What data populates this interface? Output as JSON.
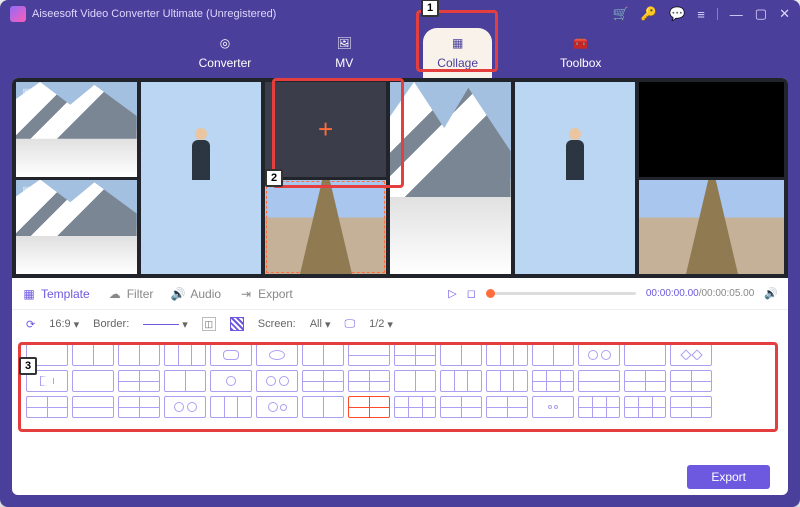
{
  "title": "Aiseesoft Video Converter Ultimate (Unregistered)",
  "main_tabs": {
    "converter": "Converter",
    "mv": "MV",
    "collage": "Collage",
    "toolbox": "Toolbox"
  },
  "subtabs": {
    "template": "Template",
    "filter": "Filter",
    "audio": "Audio",
    "export": "Export"
  },
  "playback": {
    "current": "00:00:00.00",
    "total": "00:00:05.00"
  },
  "options": {
    "ratio": "16:9",
    "border_label": "Border:",
    "screen_label": "Screen:",
    "screen_value": "All",
    "page": "1/2"
  },
  "callouts": {
    "c1": "1",
    "c2": "2",
    "c3": "3"
  },
  "export_button": "Export"
}
